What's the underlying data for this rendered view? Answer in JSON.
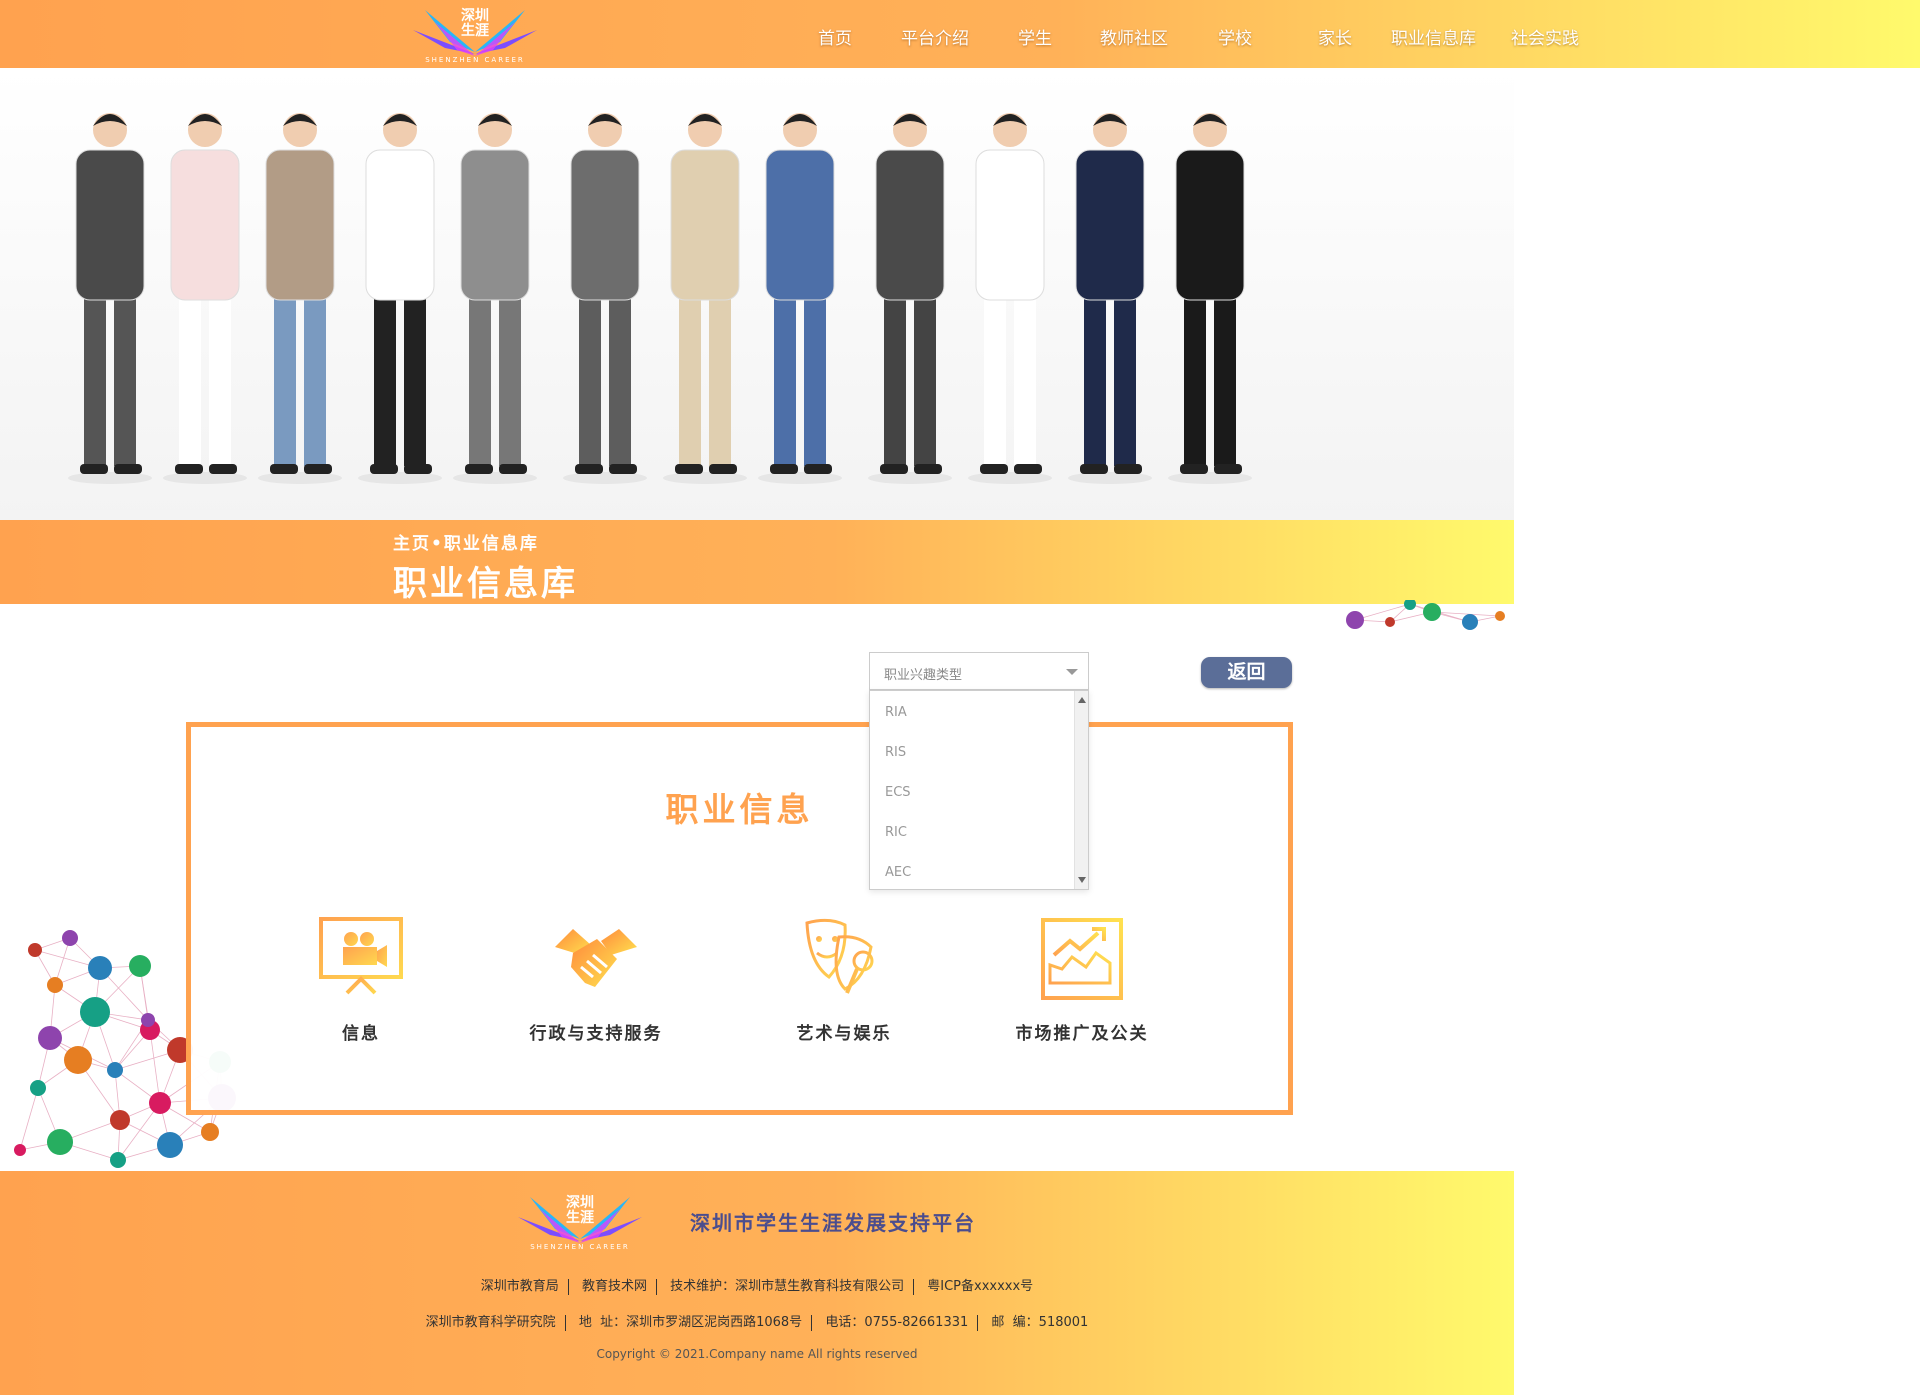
{
  "colors": {
    "accent": "#ffa24f",
    "gradient_end": "#fffa6c",
    "back_button": "#5b6e98",
    "footer_title": "#4b4d8e"
  },
  "brand": {
    "logo_text_line1": "深圳",
    "logo_text_line2": "生涯",
    "logo_subtitle": "SHENZHEN CAREER"
  },
  "nav": {
    "items": [
      "首页",
      "平台介绍",
      "学生",
      "教师社区",
      "学校",
      "家长",
      "职业信息库",
      "社会实践"
    ]
  },
  "banner": {
    "breadcrumb": "主页•职业信息库",
    "title": "职业信息库"
  },
  "filter": {
    "placeholder": "职业兴趣类型",
    "options": [
      "RIA",
      "RIS",
      "ECS",
      "RIC",
      "AEC"
    ],
    "back_label": "返回"
  },
  "panel": {
    "title": "职业信息",
    "categories": [
      {
        "label": "信息",
        "icon": "film-projector-monitor-icon"
      },
      {
        "label": "行政与支持服务",
        "icon": "handshake-icon"
      },
      {
        "label": "艺术与娱乐",
        "icon": "theater-masks-microphone-icon"
      },
      {
        "label": "市场推广及公关",
        "icon": "growth-chart-icon"
      }
    ]
  },
  "footer": {
    "title": "深圳市学生生涯发展支持平台",
    "row1": [
      "深圳市教育局",
      "教育技术网",
      "技术维护：深圳市慧生教育科技有限公司",
      "粤ICP备xxxxxx号"
    ],
    "row2": [
      "深圳市教育科学研究院",
      "地  址：深圳市罗湖区泥岗西路1068号",
      "电话：0755-82661331",
      "邮  编：518001"
    ],
    "copyright": "Copyright © 2021.Company name All rights reserved"
  }
}
